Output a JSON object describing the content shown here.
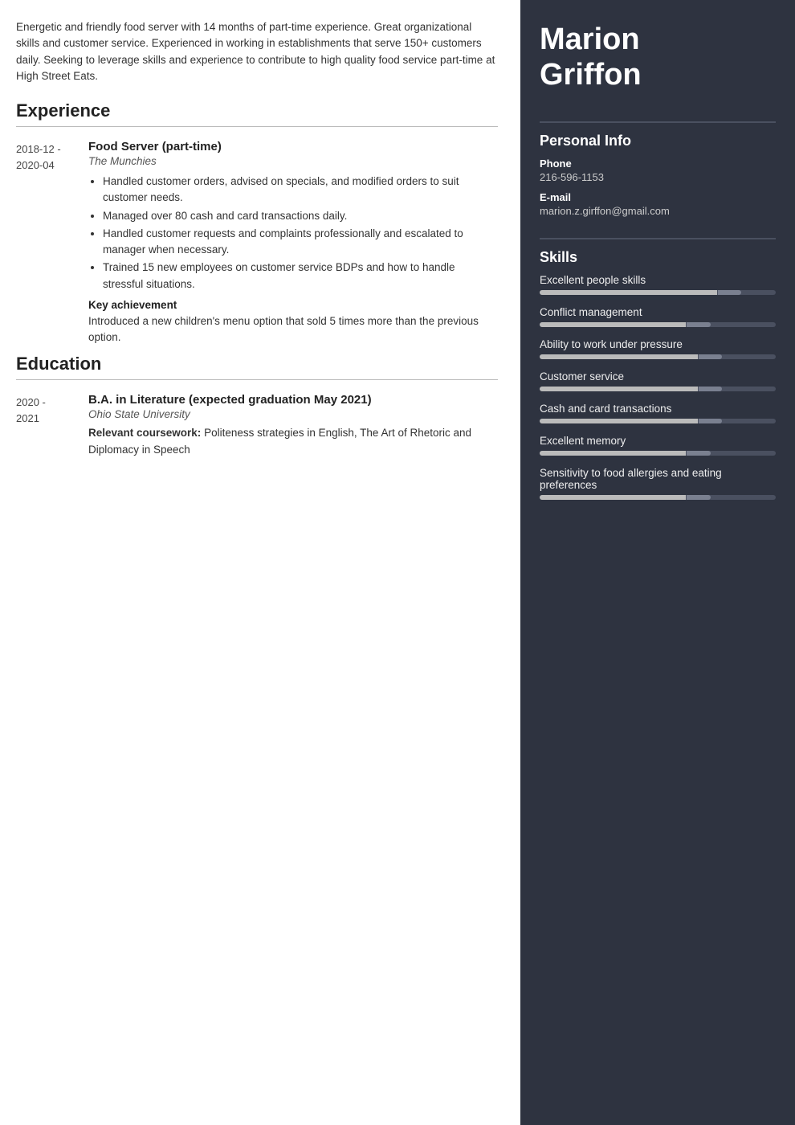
{
  "summary": "Energetic and friendly food server with 14 months of part-time experience. Great organizational skills and customer service. Experienced in working in establishments that serve 150+ customers daily. Seeking to leverage skills and experience to contribute to high quality food service part-time at High Street Eats.",
  "sections": {
    "experience_label": "Experience",
    "education_label": "Education"
  },
  "experience": [
    {
      "date": "2018-12 -\n2020-04",
      "job_title": "Food Server (part-time)",
      "company": "The Munchies",
      "bullets": [
        "Handled customer orders, advised on specials, and modified orders to suit customer needs.",
        "Managed over 80 cash and card transactions daily.",
        "Handled customer requests and complaints professionally and escalated to manager when necessary.",
        "Trained 15 new employees on customer service BDPs and how to handle stressful situations."
      ],
      "key_achievement_label": "Key achievement",
      "key_achievement": "Introduced a new children's menu option that sold 5 times more than the previous option."
    }
  ],
  "education": [
    {
      "date": "2020 -\n2021",
      "degree": "B.A. in Literature (expected graduation May 2021)",
      "institution": "Ohio State University",
      "coursework_label": "Relevant coursework:",
      "coursework": "Politeness strategies in English, The Art of Rhetoric and Diplomacy in Speech"
    }
  ],
  "right": {
    "name_line1": "Marion",
    "name_line2": "Griffon",
    "personal_info_label": "Personal Info",
    "phone_label": "Phone",
    "phone_value": "216-596-1153",
    "email_label": "E-mail",
    "email_value": "marion.z.girffon@gmail.com",
    "skills_label": "Skills",
    "skills": [
      {
        "name": "Excellent people skills",
        "filled": 75,
        "accent": 10
      },
      {
        "name": "Conflict management",
        "filled": 62,
        "accent": 10
      },
      {
        "name": "Ability to work under pressure",
        "filled": 67,
        "accent": 10
      },
      {
        "name": "Customer service",
        "filled": 67,
        "accent": 10
      },
      {
        "name": "Cash and card transactions",
        "filled": 67,
        "accent": 10
      },
      {
        "name": "Excellent memory",
        "filled": 62,
        "accent": 10
      },
      {
        "name": "Sensitivity to food allergies and eating preferences",
        "filled": 62,
        "accent": 10
      }
    ]
  }
}
